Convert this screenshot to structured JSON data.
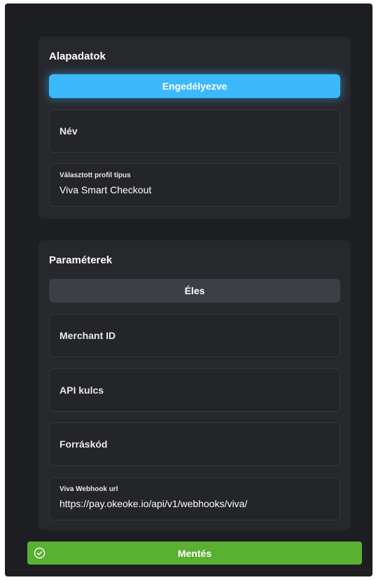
{
  "basic": {
    "title": "Alapadatok",
    "enabled_button": "Engedélyezve",
    "name_placeholder": "Név",
    "profile_type_label": "Választott profil típus",
    "profile_type_value": "Viva Smart Checkout"
  },
  "params": {
    "title": "Paraméterek",
    "environment_button": "Éles",
    "merchant_id_placeholder": "Merchant ID",
    "api_key_placeholder": "API kulcs",
    "source_code_placeholder": "Forráskód",
    "webhook_label": "Viva Webhook url",
    "webhook_value": "https://pay.okeoke.io/api/v1/webhooks/viva/"
  },
  "save": {
    "label": "Mentés",
    "icon": "check-circle-icon"
  },
  "colors": {
    "panel": "#1d1e21",
    "card": "#27282c",
    "accent_blue": "#3cb8fc",
    "save_green": "#5ab031",
    "environment_button": "#3e3f46"
  }
}
